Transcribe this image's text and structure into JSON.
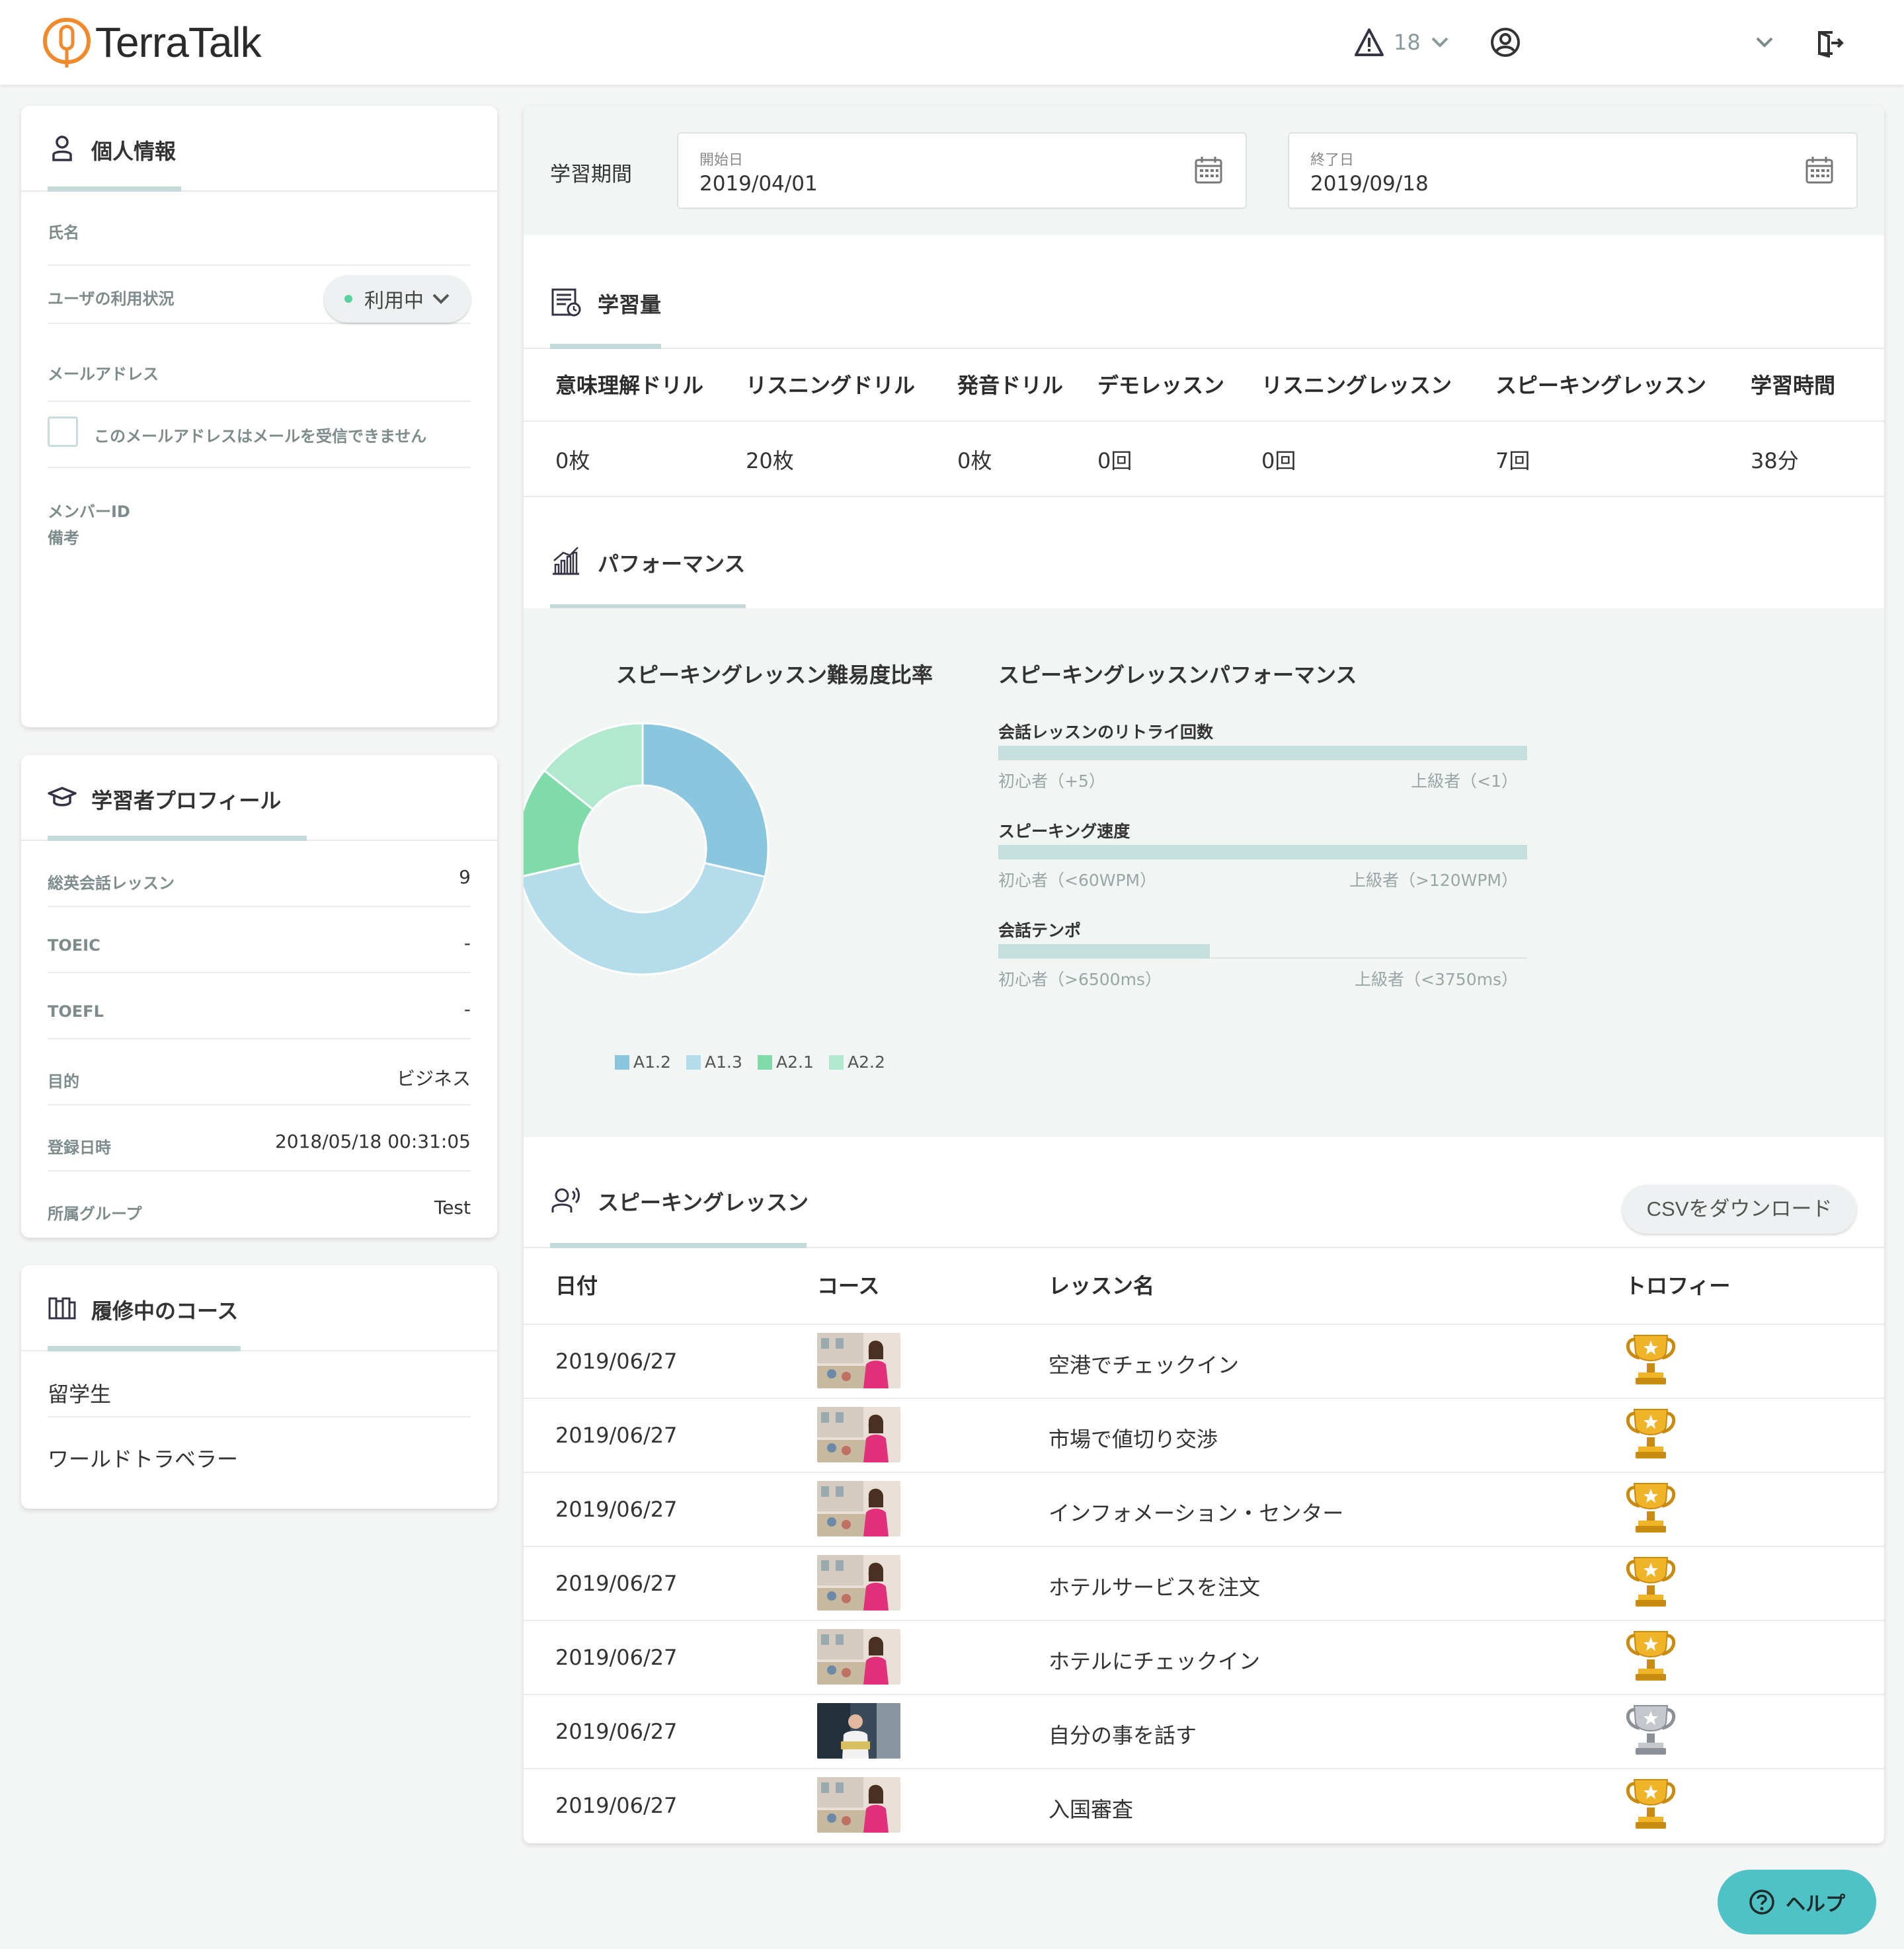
{
  "brand": {
    "name": "TerraTalk",
    "color": "#f08a2c"
  },
  "header": {
    "alert_count": "18",
    "icons": [
      "warning-icon",
      "chevron-down-icon",
      "user-circle-icon",
      "chevron-down-icon",
      "logout-icon"
    ]
  },
  "personal": {
    "title": "個人情報",
    "name_label": "氏名",
    "status_label": "ユーザの利用状況",
    "status_value": "利用中",
    "status_color": "#5ad1a0",
    "email_label": "メールアドレス",
    "email_checkbox_label": "このメールアドレスはメールを受信できません",
    "member_id_label": "メンバーID",
    "notes_label": "備考"
  },
  "profile": {
    "title": "学習者プロフィール",
    "rows": [
      {
        "label": "総英会話レッスン",
        "value": "9"
      },
      {
        "label": "TOEIC",
        "value": "-"
      },
      {
        "label": "TOEFL",
        "value": "-"
      },
      {
        "label": "目的",
        "value": "ビジネス"
      },
      {
        "label": "登録日時",
        "value": "2018/05/18 00:31:05"
      },
      {
        "label": "所属グループ",
        "value": "Test"
      }
    ]
  },
  "courses": {
    "title": "履修中のコース",
    "items": [
      "留学生",
      "ワールドトラベラー"
    ]
  },
  "period": {
    "label": "学習期間",
    "start_label": "開始日",
    "start_value": "2019/04/01",
    "end_label": "終了日",
    "end_value": "2019/09/18"
  },
  "volume": {
    "title": "学習量",
    "headers": [
      "意味理解ドリル",
      "リスニングドリル",
      "発音ドリル",
      "デモレッスン",
      "リスニングレッスン",
      "スピーキングレッスン",
      "学習時間"
    ],
    "values": [
      "0枚",
      "20枚",
      "0枚",
      "0回",
      "0回",
      "7回",
      "38分"
    ]
  },
  "performance": {
    "title": "パフォーマンス",
    "pie_title": "スピーキングレッスン難易度比率",
    "bars_title": "スピーキングレッスンパフォーマンス",
    "bars": [
      {
        "label": "会話レッスンのリトライ回数",
        "fill": 1.0,
        "low": "初心者（+5）",
        "high": "上級者（<1）"
      },
      {
        "label": "スピーキング速度",
        "fill": 1.0,
        "low": "初心者（<60WPM）",
        "high": "上級者（>120WPM）"
      },
      {
        "label": "会話テンポ",
        "fill": 0.4,
        "low": "初心者（>6500ms）",
        "high": "上級者（<3750ms）"
      }
    ]
  },
  "chart_data": {
    "type": "pie",
    "title": "スピーキングレッスン難易度比率",
    "categories": [
      "A1.2",
      "A1.3",
      "A2.1",
      "A2.2"
    ],
    "values": [
      2,
      3,
      1,
      1
    ],
    "colors": [
      "#8ac7df",
      "#b5dceb",
      "#7fdca9",
      "#b0e9cf"
    ],
    "legend": "bottom"
  },
  "lessons": {
    "title": "スピーキングレッスン",
    "csv_label": "CSVをダウンロード",
    "headers": [
      "日付",
      "コース",
      "レッスン名",
      "トロフィー"
    ],
    "rows": [
      {
        "date": "2019/06/27",
        "course_img": "traveler",
        "name": "空港でチェックイン",
        "trophy": "gold"
      },
      {
        "date": "2019/06/27",
        "course_img": "traveler",
        "name": "市場で値切り交渉",
        "trophy": "gold"
      },
      {
        "date": "2019/06/27",
        "course_img": "traveler",
        "name": "インフォメーション・センター",
        "trophy": "gold"
      },
      {
        "date": "2019/06/27",
        "course_img": "traveler",
        "name": "ホテルサービスを注文",
        "trophy": "gold"
      },
      {
        "date": "2019/06/27",
        "course_img": "traveler",
        "name": "ホテルにチェックイン",
        "trophy": "gold"
      },
      {
        "date": "2019/06/27",
        "course_img": "business",
        "name": "自分の事を話す",
        "trophy": "silver"
      },
      {
        "date": "2019/06/27",
        "course_img": "traveler",
        "name": "入国審査",
        "trophy": "gold"
      }
    ]
  },
  "help": {
    "label": "ヘルプ"
  }
}
